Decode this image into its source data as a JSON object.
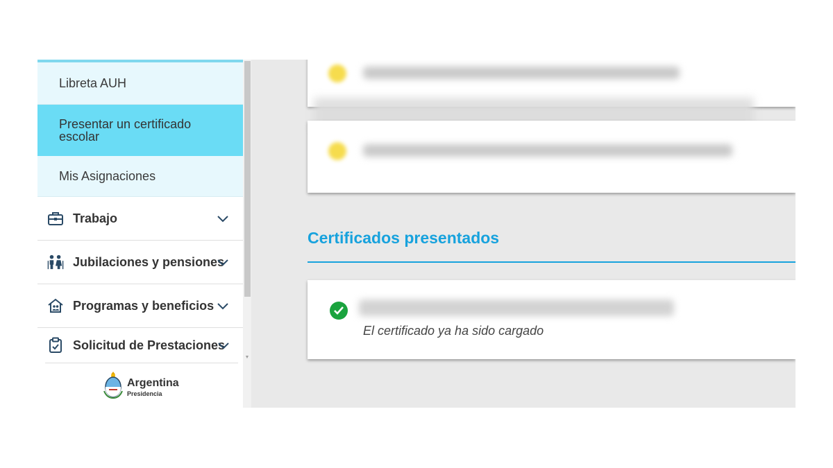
{
  "sidebar": {
    "sub_items": [
      {
        "label": "Libreta AUH"
      },
      {
        "label_line1": "Presentar un certificado",
        "label_line2": "escolar"
      },
      {
        "label": "Mis Asignaciones"
      }
    ],
    "nav_items": [
      {
        "label": "Trabajo",
        "icon": "briefcase-icon"
      },
      {
        "label": "Jubilaciones y pensiones",
        "icon": "elderly-couple-icon"
      },
      {
        "label": "Programas y beneficios",
        "icon": "home-family-icon"
      },
      {
        "label": "Solicitud de Prestaciones",
        "icon": "clipboard-check-icon"
      }
    ],
    "logo": {
      "brand": "Argentina",
      "sub": "Presidencia"
    }
  },
  "main": {
    "section_title": "Certificados presentados",
    "presented_status": "El certificado ya ha sido cargado"
  },
  "colors": {
    "accent": "#17a2dd",
    "active_item": "#6adcf5",
    "sub_item_bg": "#e7f8fd",
    "success": "#1aa33e",
    "pending": "#f6dc4d"
  }
}
